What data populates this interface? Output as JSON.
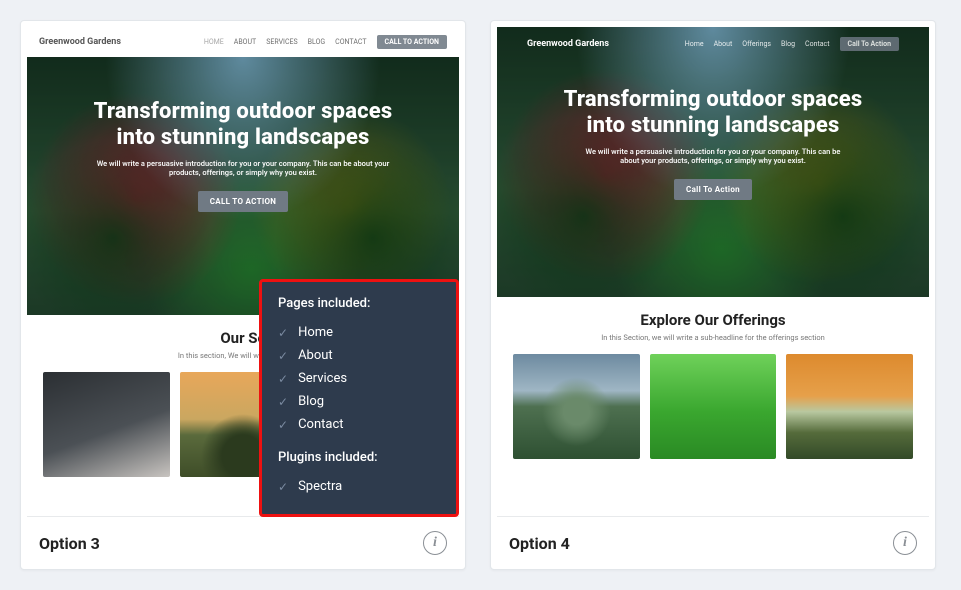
{
  "options": [
    {
      "label": "Option 3",
      "site": {
        "brand": "Greenwood Gardens",
        "theme": "light",
        "nav": [
          "HOME",
          "ABOUT",
          "SERVICES",
          "BLOG",
          "CONTACT"
        ],
        "nav_active": "HOME",
        "nav_cta": "CALL TO ACTION",
        "hero_headline": "Transforming outdoor spaces into stunning landscapes",
        "hero_sub": "We will write a persuasive introduction for you or your company. This can be about your products, offerings, or simply why you exist.",
        "hero_cta": "CALL TO ACTION",
        "section_title": "Our Services",
        "section_truncated": "Our Se",
        "section_sub": "In this section, We will write a sub-headline for the services section",
        "section_sub_truncated": "In this section, We will write a sub-head"
      },
      "tooltip": {
        "pages_header": "Pages included:",
        "pages": [
          "Home",
          "About",
          "Services",
          "Blog",
          "Contact"
        ],
        "plugins_header": "Plugins included:",
        "plugins": [
          "Spectra"
        ]
      }
    },
    {
      "label": "Option 4",
      "site": {
        "brand": "Greenwood Gardens",
        "theme": "dark",
        "nav": [
          "Home",
          "About",
          "Offerings",
          "Blog",
          "Contact"
        ],
        "nav_cta": "Call To Action",
        "hero_headline": "Transforming outdoor spaces into stunning landscapes",
        "hero_sub": "We will write a persuasive introduction for you or your company. This can be about your products, offerings, or simply why you exist.",
        "hero_cta": "Call To Action",
        "section_title": "Explore Our Offerings",
        "section_sub": "In this Section, we will write a sub-headline for the offerings section"
      }
    }
  ],
  "info_glyph": "i",
  "check_glyph": "✓"
}
